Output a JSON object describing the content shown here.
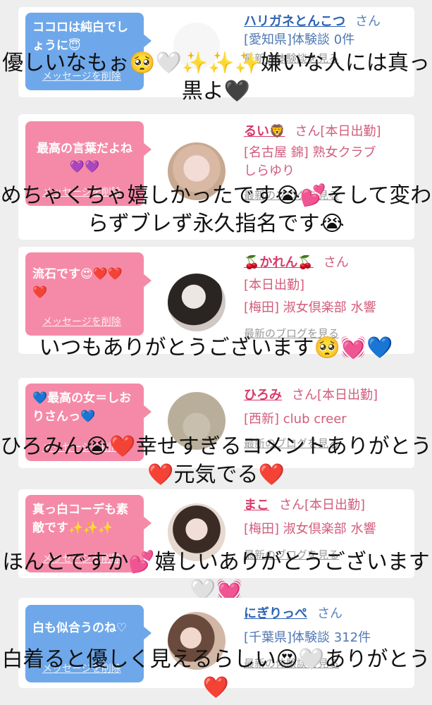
{
  "cards": [
    {
      "bubble": "ココロは純白でしょうに😇",
      "delete_label": "メッセージを削除",
      "name": "ハリガネとんこつ",
      "honorific": "さん",
      "line1": "[愛知県]体験談 0件",
      "line2": "",
      "line3": "",
      "more": "最新の体験談を見る",
      "caption": "優しいなもぉ🥺🤍✨✨✨嫌いな人には真っ黒よ🖤"
    },
    {
      "bubble": "最高の言葉だよね💜💜",
      "delete_label": "メッセージを削除",
      "name": "るい🦁",
      "honorific": "さん[本日出勤]",
      "line1": "[名古屋 錦] 熟女クラブ",
      "line2": "しらゆり",
      "line3": "",
      "more": "最新のブログを見る",
      "caption": "めちゃくちゃ嬉しかったです😭💕そして変わらずブレず永久指名です😭"
    },
    {
      "bubble": "流石です😍❤️❤️❤️",
      "delete_label": "メッセージを削除",
      "name": "🍒かれん🍒",
      "honorific": "さん",
      "line1": "[本日出勤]",
      "line2": "[梅田] 淑女倶楽部 水響",
      "line3": "",
      "more": "最新のブログを見る",
      "caption": "いつもありがとうございます🥺💓💙"
    },
    {
      "bubble": "💙最高の女＝しおりさんっ💙",
      "delete_label": "メッセージを削除",
      "name": "ひろみ",
      "honorific": "さん[本日出勤]",
      "line1": "[西新] club creer",
      "line2": "",
      "line3": "",
      "more": "最新のブログを見る",
      "caption": "ひろみん😭❤️幸せすぎるコメントありがとう❤️元気でる❤️"
    },
    {
      "bubble": "真っ白コーデも素敵です✨✨✨",
      "delete_label": "メッセージを削除",
      "name": "まこ",
      "honorific": "さん[本日出勤]",
      "line1": "[梅田] 淑女倶楽部 水響",
      "line2": "",
      "line3": "",
      "more": "最新のブログを見る",
      "caption": "ほんとですか💕嬉しいありがとうございます🤍💓"
    },
    {
      "bubble": "白も似合うのね♡",
      "delete_label": "メッセージを削除",
      "name": "にぎりっぺ",
      "honorific": "さん",
      "line1": "[千葉県]体験談 312件",
      "line2": "",
      "line3": "",
      "more": "最新の体験談を見る",
      "caption": "白着ると優しく見えるらしい😍🤍ありがとう❤️"
    }
  ],
  "colors": {
    "background": "#eeeeef",
    "bubble_blue": "#6ea8ea",
    "bubble_pink": "#f58aa8",
    "name_blue": "#2d63b2",
    "name_pink": "#d83a6a"
  }
}
